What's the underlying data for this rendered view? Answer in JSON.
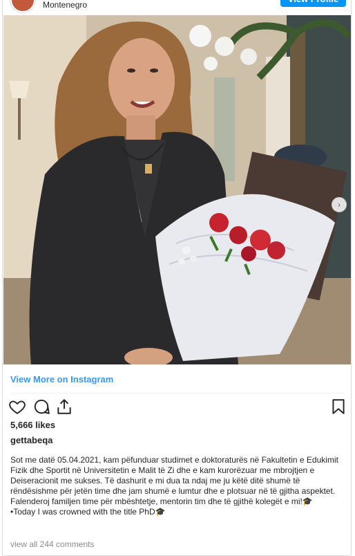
{
  "header": {
    "location": "Montenegro",
    "view_profile_label": "View Profile"
  },
  "post": {
    "next_icon": "chevron-right-icon",
    "carousel_count": 2,
    "carousel_active": 1
  },
  "view_more_label": "View More on Instagram",
  "actions": {
    "like_icon": "heart-icon",
    "comment_icon": "comment-icon",
    "share_icon": "share-icon",
    "save_icon": "bookmark-icon"
  },
  "likes_text": "5,666 likes",
  "username": "gettabeqa",
  "caption": "Sot me datë 05.04.2021, kam pëfunduar studimet e doktoraturës në Fakultetin e Edukimit Fizik dhe Sportit në Universitetin e Malit të Zi dhe e kam kurorëzuar me mbrojtjen e Deiseracionit me sukses. Të dashurit e mi dua ta ndaj me ju këtë ditë shumë të rëndësishme për jetën time dhe jam shumë e lumtur dhe e plotsuar në të gjitha aspektet. Falenderoj familjen time për mbështetje, mentorin tim dhe të gjithë kolegët e mi!🎓\n•Today I was crowned with the title PhD🎓",
  "comments_link": "view all 244 comments",
  "colors": {
    "accent": "#0095f6",
    "link": "#3897f0",
    "muted": "#8e8e8e"
  }
}
